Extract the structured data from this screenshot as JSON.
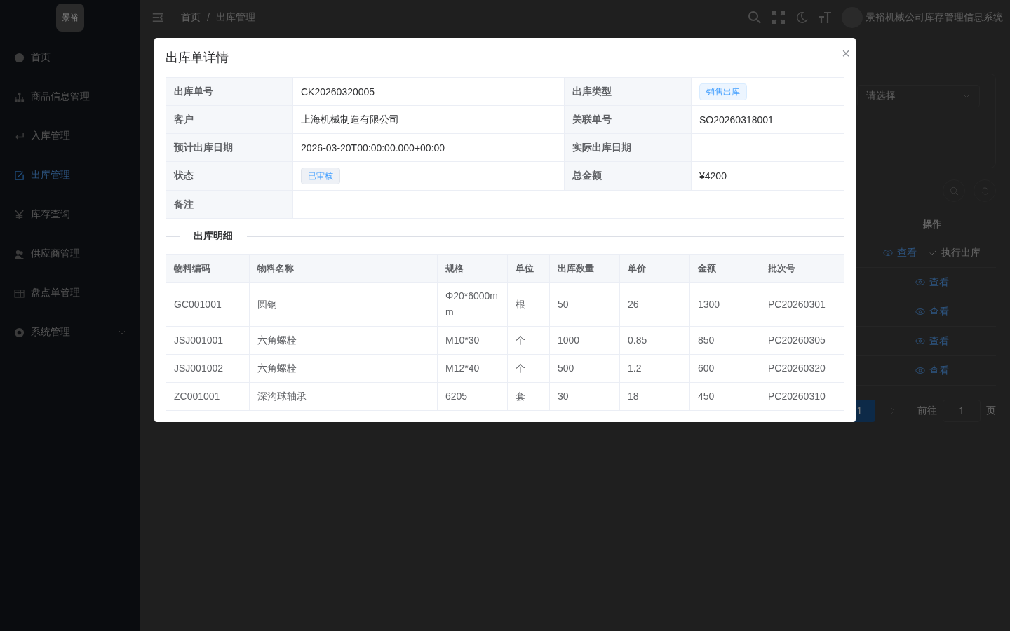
{
  "sidebar": {
    "logo": "景裕",
    "items": [
      {
        "label": "首页",
        "kind": "link",
        "selected": false
      },
      {
        "label": "商品信息管理",
        "kind": "link",
        "selected": false
      },
      {
        "label": "入库管理",
        "kind": "link",
        "selected": false
      },
      {
        "label": "出库管理",
        "kind": "link",
        "selected": true
      },
      {
        "label": "库存查询",
        "kind": "link",
        "selected": false
      },
      {
        "label": "供应商管理",
        "kind": "link",
        "selected": false
      },
      {
        "label": "盘点单管理",
        "kind": "link",
        "selected": false
      },
      {
        "label": "系统管理",
        "kind": "group",
        "selected": false
      }
    ]
  },
  "header": {
    "breadcrumb": [
      "首页",
      "出库管理"
    ],
    "separator": "/",
    "user_name": "景裕机械公司库存管理信息系统"
  },
  "page": {
    "filter": {
      "select_placeholder": "请选择"
    },
    "table": {
      "action_column": "操作",
      "rows": [
        [
          "查看",
          "执行出库"
        ],
        [
          "查看"
        ],
        [
          "查看"
        ],
        [
          "查看"
        ],
        [
          "查看"
        ]
      ]
    },
    "pagination": {
      "current": "1",
      "goto_label": "前往",
      "goto_value": "1",
      "goto_suffix": "页"
    }
  },
  "dialog": {
    "title": "出库单详情",
    "close": "×",
    "fields": [
      [
        {
          "label": "出库单号",
          "value": "CK20260320005",
          "kind": "text"
        },
        {
          "label": "出库类型",
          "value": "销售出库",
          "kind": "tag"
        }
      ],
      [
        {
          "label": "客户",
          "value": "上海机械制造有限公司",
          "kind": "text"
        },
        {
          "label": "关联单号",
          "value": "SO20260318001",
          "kind": "text"
        }
      ],
      [
        {
          "label": "预计出库日期",
          "value": "2026-03-20T00:00:00.000+00:00",
          "kind": "text"
        },
        {
          "label": "实际出库日期"
        }
      ],
      [
        {
          "label": "状态",
          "value": "已审核",
          "kind": "status"
        },
        {
          "label": "总金额",
          "value": "¥4200",
          "kind": "text"
        }
      ],
      [
        {
          "label": "备注"
        }
      ]
    ],
    "section_title": "出库明细",
    "columns": [
      "物料编码",
      "物料名称",
      "规格",
      "单位",
      "出库数量",
      "单价",
      "金额",
      "批次号"
    ],
    "rows": [
      [
        "GC001001",
        "圆钢",
        "Φ20*6000mm",
        "根",
        "50",
        "26",
        "1300",
        "PC20260301"
      ],
      [
        "JSJ001001",
        "六角螺栓",
        "M10*30",
        "个",
        "1000",
        "0.85",
        "850",
        "PC20260305"
      ],
      [
        "JSJ001002",
        "六角螺栓",
        "M12*40",
        "个",
        "500",
        "1.2",
        "600",
        "PC20260320"
      ],
      [
        "ZC001001",
        "深沟球轴承",
        "6205",
        "套",
        "30",
        "18",
        "450",
        "PC20260310"
      ]
    ]
  }
}
